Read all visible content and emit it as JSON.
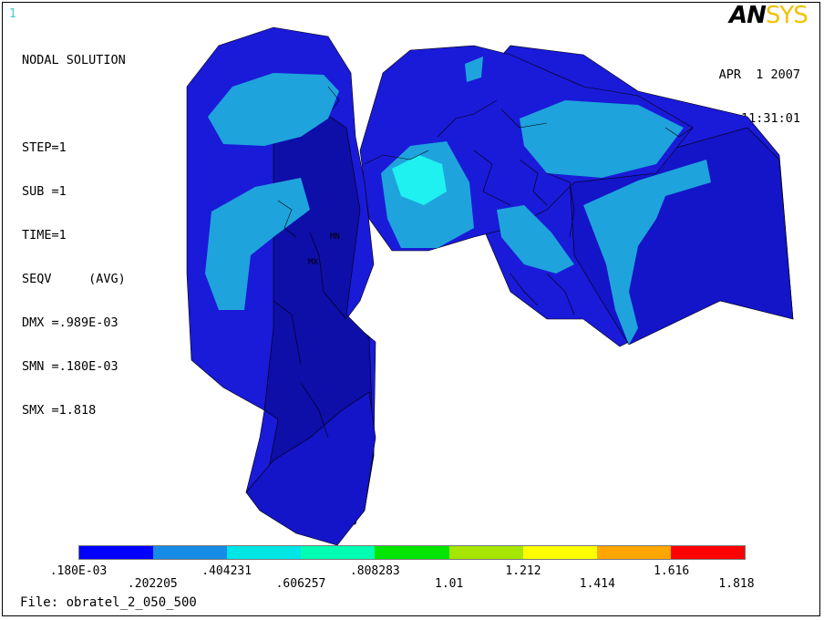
{
  "window_number": "1",
  "logo": {
    "part1": "AN",
    "part2": "SYS"
  },
  "info_lines": [
    "NODAL SOLUTION",
    "",
    "STEP=1",
    "SUB =1",
    "TIME=1",
    "SEQV     (AVG)",
    "DMX =.989E-03",
    "SMN =.180E-03",
    "SMX =1.818"
  ],
  "date": "APR  1 2007",
  "time": "11:31:01",
  "node_labels": {
    "min": "MN",
    "max": "MX"
  },
  "legend": {
    "colors": [
      "#0000ff",
      "#178ce6",
      "#00e6e6",
      "#00ffb3",
      "#00e600",
      "#a6e600",
      "#ffff00",
      "#ffa600",
      "#ff0000"
    ],
    "labels_top": [
      ".180E-03",
      ".404231",
      ".808283",
      "1.212",
      "1.616"
    ],
    "labels_bottom": [
      ".202205",
      ".606257",
      "1.01",
      "1.414",
      "1.818"
    ]
  },
  "file_label": "File: obratel_2_050_500",
  "model_colors": {
    "dark": "#1a1ad9",
    "mid": "#1414c8",
    "shade": "#0e0ea8",
    "light": "#1fa3dc",
    "cyan": "#1ff0f0"
  }
}
